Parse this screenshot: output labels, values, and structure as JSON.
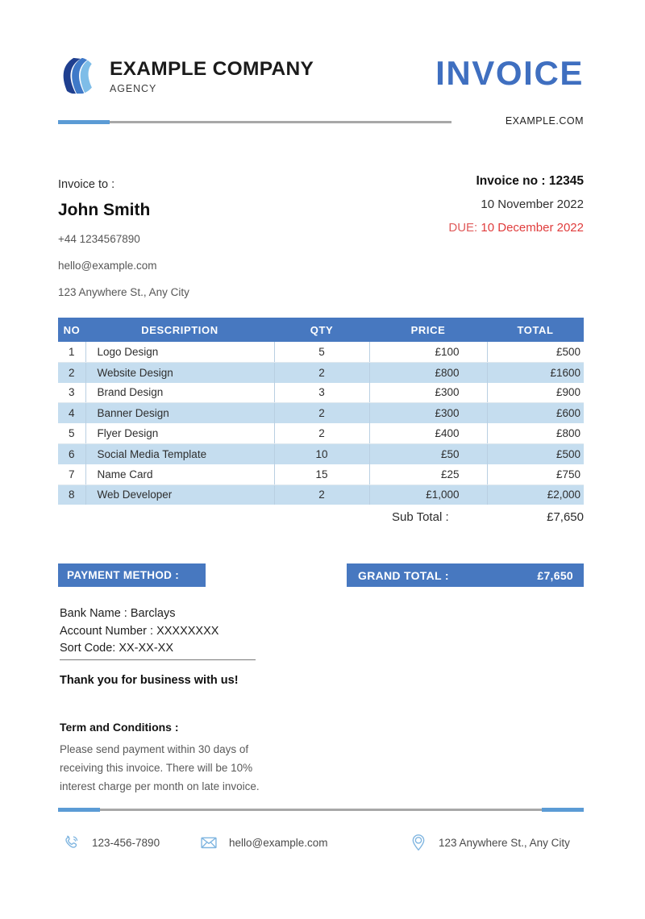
{
  "header": {
    "logo_icon": "swoosh-circle-logo",
    "company_name": "EXAMPLE COMPANY",
    "company_tagline": "AGENCY",
    "document_title": "INVOICE",
    "website": "EXAMPLE.COM"
  },
  "bill_to": {
    "label": "Invoice to :",
    "name": "John Smith",
    "phone": "+44 1234567890",
    "email": "hello@example.com",
    "address": "123 Anywhere St., Any City"
  },
  "meta": {
    "invoice_no": "Invoice no : 12345",
    "issue_date": "10 November 2022",
    "due_label": "DUE:",
    "due_date": "10 December 2022"
  },
  "table": {
    "columns": [
      "NO",
      "DESCRIPTION",
      "QTY",
      "PRICE",
      "TOTAL"
    ],
    "rows": [
      {
        "no": "1",
        "description": "Logo Design",
        "qty": "5",
        "price": "£100",
        "total": "£500"
      },
      {
        "no": "2",
        "description": "Website Design",
        "qty": "2",
        "price": "£800",
        "total": "£1600"
      },
      {
        "no": "3",
        "description": "Brand Design",
        "qty": "3",
        "price": "£300",
        "total": "£900"
      },
      {
        "no": "4",
        "description": "Banner Design",
        "qty": "2",
        "price": "£300",
        "total": "£600"
      },
      {
        "no": "5",
        "description": "Flyer Design",
        "qty": "2",
        "price": "£400",
        "total": "£800"
      },
      {
        "no": "6",
        "description": "Social Media Template",
        "qty": "10",
        "price": "£50",
        "total": "£500"
      },
      {
        "no": "7",
        "description": "Name Card",
        "qty": "15",
        "price": "£25",
        "total": "£750"
      },
      {
        "no": "8",
        "description": "Web Developer",
        "qty": "2",
        "price": "£1,000",
        "total": "£2,000"
      }
    ]
  },
  "summary": {
    "subtotal_label": "Sub Total :",
    "subtotal_value": "£7,650",
    "grand_total_label": "GRAND TOTAL :",
    "grand_total_value": "£7,650"
  },
  "payment": {
    "heading": "PAYMENT METHOD :",
    "bank_name": "Bank Name : Barclays",
    "account_number": "Account Number : XXXXXXXX",
    "sort_code": "Sort Code: XX-XX-XX",
    "thanks": "Thank you for business with us!"
  },
  "terms": {
    "title": "Term and Conditions :",
    "body": "Please send payment within 30 days of receiving this invoice. There will be 10% interest charge per month on late invoice."
  },
  "footer": {
    "phone_icon": "phone-icon",
    "phone": "123-456-7890",
    "mail_icon": "envelope-icon",
    "email": "hello@example.com",
    "location_icon": "map-pin-icon",
    "address": "123 Anywhere St., Any City"
  },
  "colors": {
    "accent_blue": "#4778c0",
    "light_blue": "#5b9bd5",
    "row_tint": "#c5ddef",
    "due_red": "#e03c3c",
    "rule_gray": "#a8a8a8"
  }
}
